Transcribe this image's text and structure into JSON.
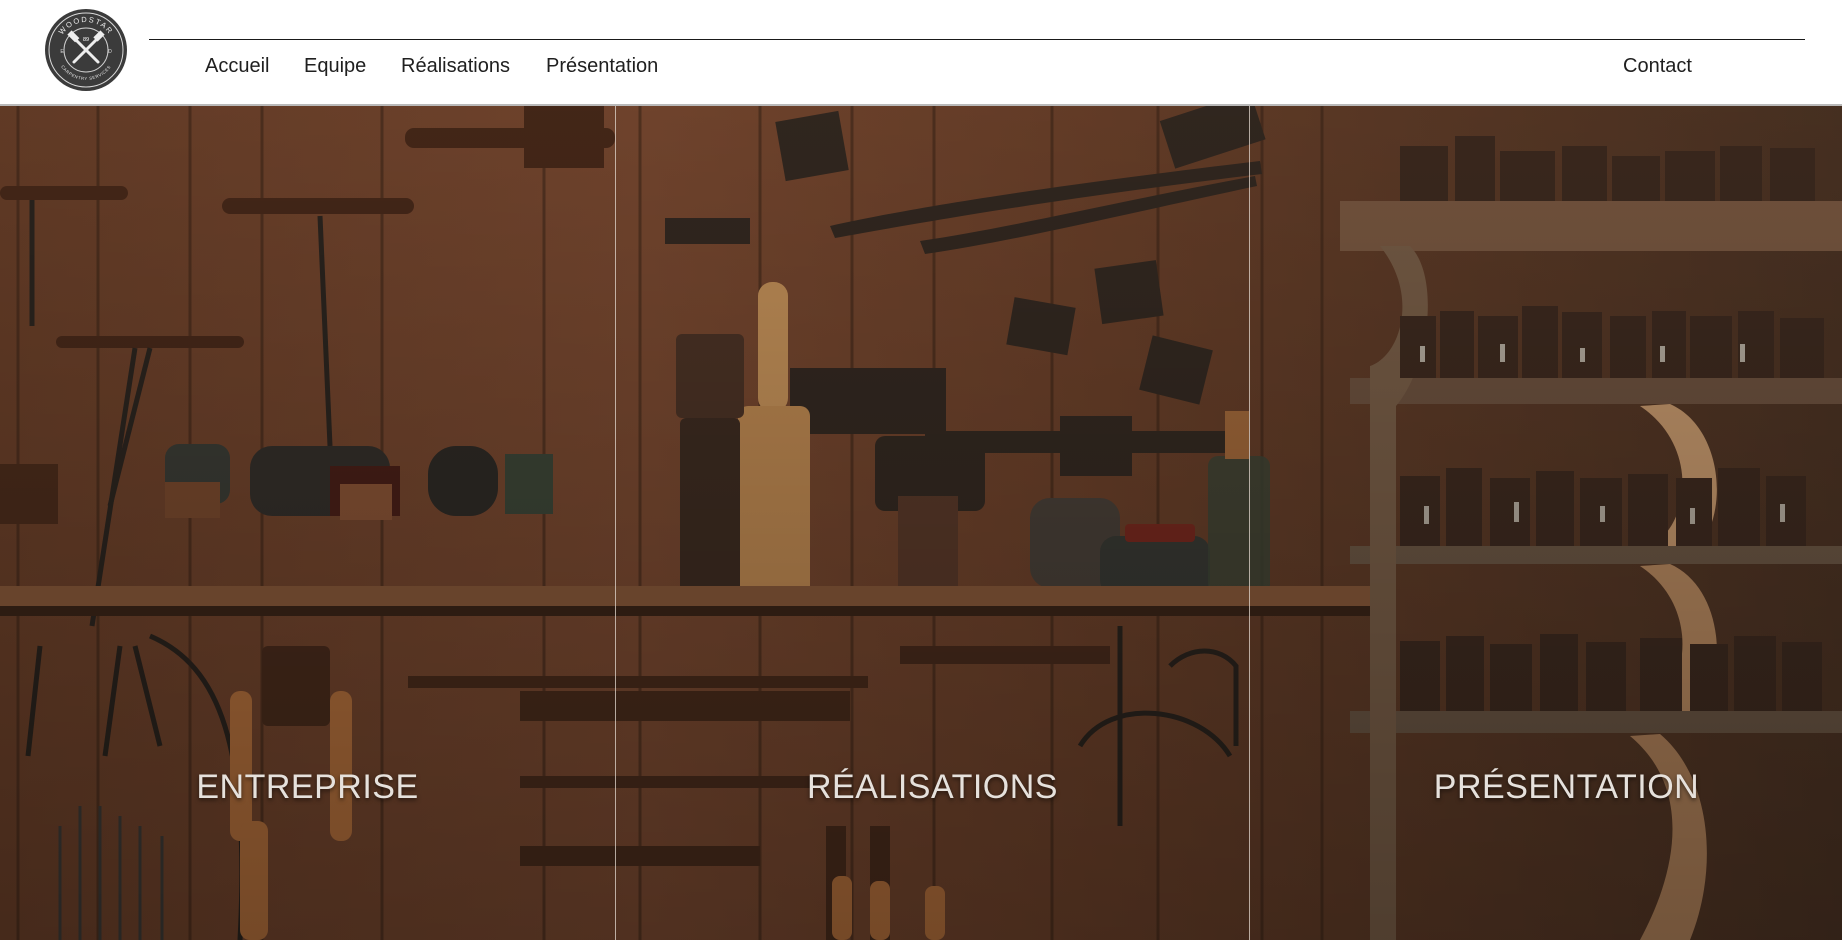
{
  "header": {
    "logo": {
      "top_text": "WOODSTAR",
      "bottom_text": "CARPENTRY SERVICES",
      "left_mark": "E",
      "right_mark": "D",
      "center_mark": "89"
    },
    "nav": [
      {
        "label": "Accueil",
        "icon": ""
      },
      {
        "label": "Equipe",
        "icon": ""
      },
      {
        "label": "Réalisations",
        "icon": ""
      },
      {
        "label": "Présentation",
        "icon": ""
      }
    ],
    "contact_label": "Contact"
  },
  "hero": {
    "panels": [
      {
        "label": "ENTREPRISE"
      },
      {
        "label": "RÉALISATIONS"
      },
      {
        "label": "PRÉSENTATION"
      }
    ]
  },
  "colors": {
    "header_bg": "#ffffff",
    "nav_text": "#202020",
    "wood_dark": "#4a2e1e",
    "wood_mid": "#7a4b31",
    "panel_text": "#e6e1dc"
  }
}
